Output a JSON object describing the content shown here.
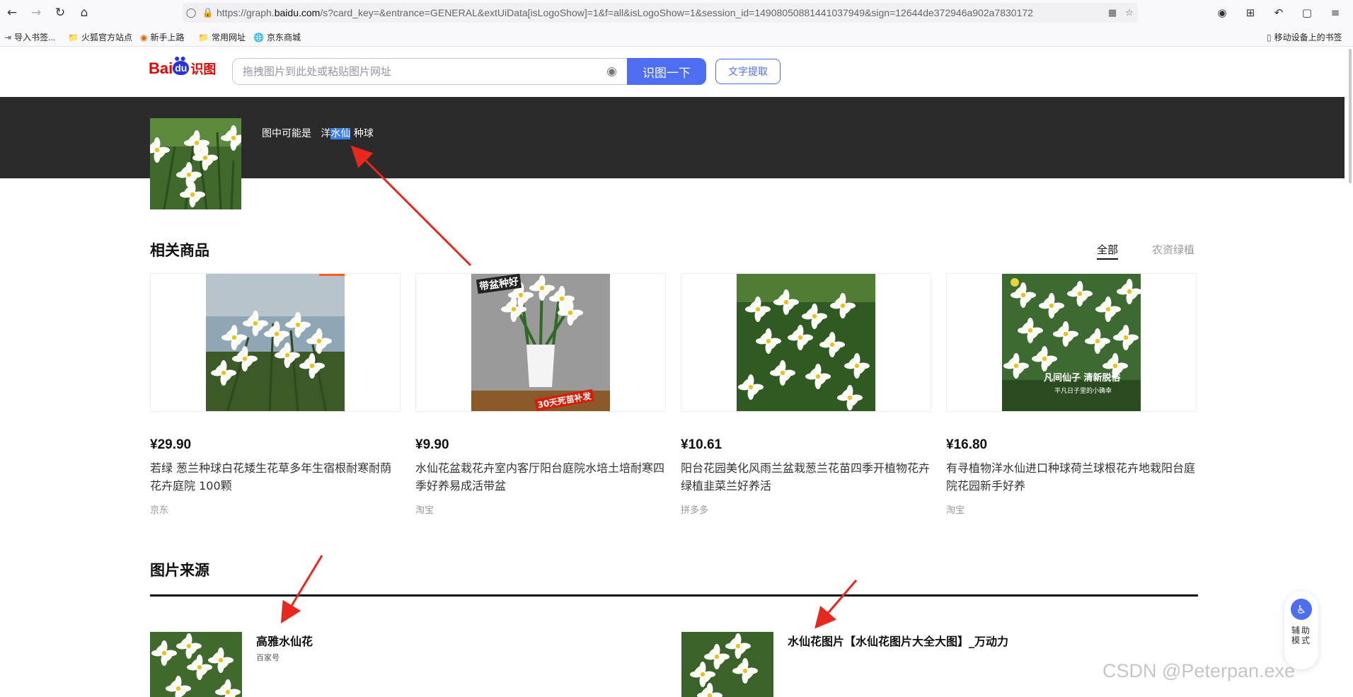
{
  "browser": {
    "url_prefix": "https://graph.",
    "url_host": "baidu.com",
    "url_rest": "/s?card_key=&entrance=GENERAL&extUiData[isLogoShow]=1&f=all&isLogoShow=1&session_id=14908050881441037949&sign=12644de372946a902a7830172",
    "nav_icons": [
      "back-icon",
      "forward-icon",
      "reload-icon",
      "home-icon"
    ],
    "right_icons": [
      "account-icon",
      "screenshot-icon",
      "undo-icon",
      "extensions-icon",
      "menu-icon"
    ]
  },
  "bookmarks": {
    "items": [
      "导入书签...",
      "火狐官方站点",
      "新手上路",
      "常用网址",
      "京东商城"
    ],
    "mobile": "移动设备上的书签"
  },
  "header": {
    "logo_bai": "Bai",
    "logo_du": "du",
    "logo_shitu": "识图",
    "search_placeholder": "拖拽图片到此处或粘贴图片网址",
    "search_button": "识图一下",
    "ocr_button": "文字提取"
  },
  "banner": {
    "guess_prefix": "图中可能是",
    "guess_a": "洋",
    "guess_highlight": "水仙",
    "guess_b": "种球"
  },
  "products": {
    "title": "相关商品",
    "tabs": [
      "全部",
      "农资绿植"
    ],
    "items": [
      {
        "price": "¥29.90",
        "title": "若绿 葱兰种球白花矮生花草多年生宿根耐寒耐荫花卉庭院 100颗",
        "shop": "京东"
      },
      {
        "price": "¥9.90",
        "title": "水仙花盆栽花卉室内客厅阳台庭院水培土培耐寒四季好养易成活带盆",
        "shop": "淘宝",
        "badge_top": "带盆种好",
        "badge_bottom": "30天死苗补发"
      },
      {
        "price": "¥10.61",
        "title": "阳台花园美化风雨兰盆栽葱兰花苗四季开植物花卉绿植韭菜兰好养活",
        "shop": "拼多多"
      },
      {
        "price": "¥16.80",
        "title": "有寻植物洋水仙进口种球荷兰球根花卉地栽阳台庭院花园新手好养",
        "shop": "淘宝",
        "overlay_1": "凡间仙子 清新脱俗",
        "overlay_2": "平凡日子里的小确幸"
      }
    ]
  },
  "sources": {
    "title": "图片来源",
    "items": [
      {
        "title": "高雅水仙花",
        "from": "百家号"
      },
      {
        "title": "水仙花图片【水仙花图片大全大图】_万动力",
        "from": ""
      }
    ]
  },
  "assist": {
    "label": "辅助模式"
  },
  "watermark": "CSDN @Peterpan.exe",
  "colors": {
    "accent": "#4e6ef2",
    "banner": "#2b2b2b",
    "highlight": "#3d7ff7",
    "arrow": "#e8281f"
  }
}
